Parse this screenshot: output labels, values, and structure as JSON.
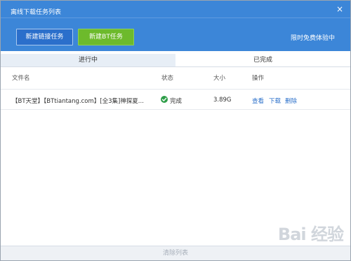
{
  "window": {
    "title": "离线下载任务列表",
    "close_glyph": "×"
  },
  "toolbar": {
    "new_link_task": "新建链接任务",
    "new_bt_task": "新建BT任务",
    "trial": "限时免费体验中"
  },
  "tabs": [
    {
      "label": "进行中",
      "active": false
    },
    {
      "label": "已完成",
      "active": true
    }
  ],
  "columns": {
    "filename": "文件名",
    "status": "状态",
    "size": "大小",
    "actions": "操作"
  },
  "rows": [
    {
      "filename": "【BT天堂】【BTtiantang.com】[全3集]神探夏...",
      "status": "完成",
      "size": "3.89G",
      "actions": [
        "查看",
        "下载",
        "删除"
      ]
    }
  ],
  "footer": {
    "clear_list": "清除列表"
  },
  "watermark": "Bai 经验",
  "icons": {
    "status": "check-circle-icon",
    "close": "close-icon"
  },
  "colors": {
    "header": "#3c86d8",
    "link_button": "#2b6fcb",
    "bt_button": "#6dba2c",
    "status_ok": "#2f9e49",
    "action_link": "#2a6fca"
  }
}
